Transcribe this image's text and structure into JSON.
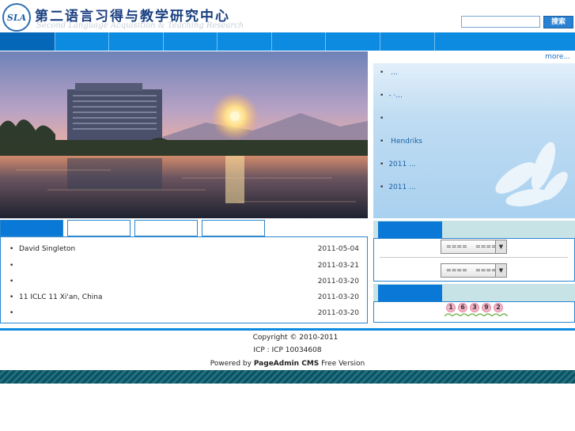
{
  "header": {
    "logo_text": "SLA",
    "site_title": "第二语言习得与教学研究中心",
    "site_subtitle": "Second Language Acquisition & Teaching Research",
    "search_placeholder": "",
    "search_button_label": "搜索"
  },
  "nav": {
    "items": [
      "",
      "",
      "",
      "",
      "",
      "",
      "",
      ""
    ]
  },
  "notice": {
    "more_label": "more...",
    "items": [
      {
        "bullet": "•",
        "text": "         ..."
      },
      {
        "bullet": "•",
        "text": "-            ·..."
      },
      {
        "bullet": "•",
        "text": ""
      },
      {
        "bullet": "•",
        "text": "  Hendriks"
      },
      {
        "bullet": "•",
        "text": "2011         ..."
      },
      {
        "bullet": "•",
        "text": "2011         ..."
      }
    ]
  },
  "tabs": [
    "",
    "",
    "",
    ""
  ],
  "news": [
    {
      "bullet": "•",
      "title": "     David Singleton",
      "date": "2011-05-04"
    },
    {
      "bullet": "•",
      "title": "",
      "date": "2011-03-21"
    },
    {
      "bullet": "•",
      "title": "",
      "date": "2011-03-20"
    },
    {
      "bullet": "•",
      "title": "11        ICLC 11 Xi'an, China",
      "date": "2011-03-20"
    },
    {
      "bullet": "•",
      "title": "",
      "date": "2011-03-20"
    }
  ],
  "links_box": {
    "tab_label": "",
    "select1_value": "====    ====",
    "select2_value": "====    ====",
    "arrow": "▼"
  },
  "counter_box": {
    "tab_label": "",
    "digits": [
      "1",
      "6",
      "3",
      "9",
      "2"
    ]
  },
  "footer": {
    "copyright": "Copyright © 2010-2011",
    "icp": "ICP   : ICP 10034608",
    "powered_prefix": "Powered by ",
    "powered_brand": "PageAdmin CMS",
    "powered_suffix": " Free Version"
  },
  "colors": {
    "nav": "#0c8be0",
    "accent": "#0a78d6",
    "footer_bar": "#0e4f5e"
  }
}
